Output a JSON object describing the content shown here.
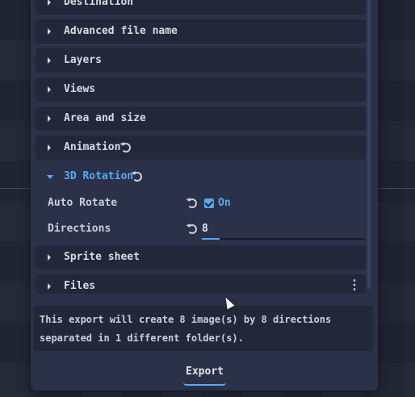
{
  "sections": [
    {
      "label": "Destination"
    },
    {
      "label": "Advanced file name"
    },
    {
      "label": "Layers"
    },
    {
      "label": "Views"
    },
    {
      "label": "Area and size"
    },
    {
      "label": "Animation"
    },
    {
      "label": "3D Rotation"
    },
    {
      "label": "Sprite sheet"
    },
    {
      "label": "Files"
    }
  ],
  "rotation": {
    "auto_rotate_label": "Auto Rotate",
    "auto_rotate_checked": true,
    "auto_rotate_value": "On",
    "directions_label": "Directions",
    "directions_value": "8",
    "directions_fill": 0.11
  },
  "info": {
    "message": "This export will create 8 image(s) by 8 directions separated in 1 different folder(s)."
  },
  "actions": {
    "export_label": "Export"
  },
  "colors": {
    "accent": "#5aa9f0",
    "panel": "#2a3148",
    "section": "#222839"
  }
}
